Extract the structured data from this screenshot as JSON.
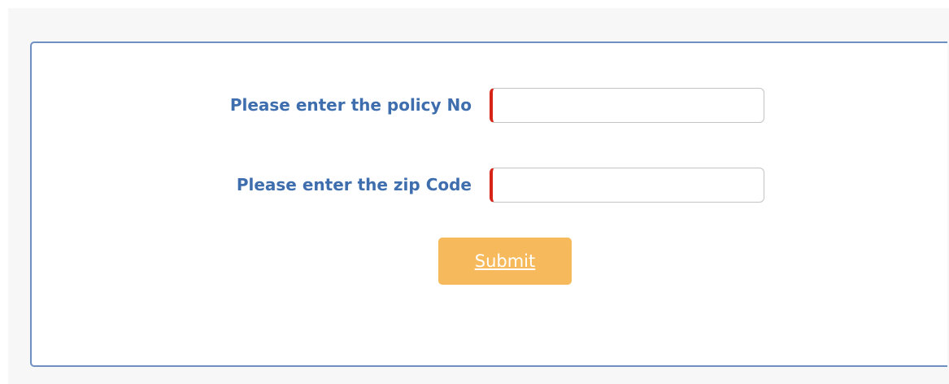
{
  "form": {
    "policy_label": "Please enter the policy No",
    "policy_value": "",
    "policy_placeholder": "",
    "zip_label": "Please enter the zip Code",
    "zip_value": "",
    "zip_placeholder": "",
    "submit_label": "Submit"
  },
  "colors": {
    "label_text": "#3e6ead",
    "panel_border": "#6e8fc2",
    "required_marker": "#d62518",
    "submit_background": "#f6b95b",
    "submit_text": "#ffffff"
  }
}
